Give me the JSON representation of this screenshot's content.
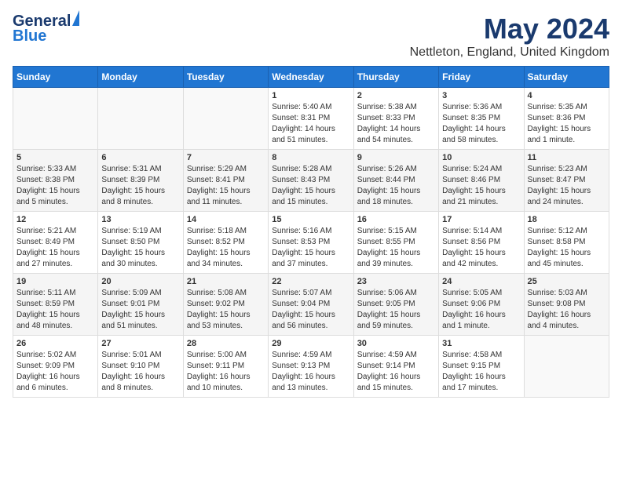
{
  "header": {
    "logo_line1": "General",
    "logo_line2": "Blue",
    "month_year": "May 2024",
    "location": "Nettleton, England, United Kingdom"
  },
  "weekdays": [
    "Sunday",
    "Monday",
    "Tuesday",
    "Wednesday",
    "Thursday",
    "Friday",
    "Saturday"
  ],
  "weeks": [
    [
      {
        "day": "",
        "info": ""
      },
      {
        "day": "",
        "info": ""
      },
      {
        "day": "",
        "info": ""
      },
      {
        "day": "1",
        "info": "Sunrise: 5:40 AM\nSunset: 8:31 PM\nDaylight: 14 hours\nand 51 minutes."
      },
      {
        "day": "2",
        "info": "Sunrise: 5:38 AM\nSunset: 8:33 PM\nDaylight: 14 hours\nand 54 minutes."
      },
      {
        "day": "3",
        "info": "Sunrise: 5:36 AM\nSunset: 8:35 PM\nDaylight: 14 hours\nand 58 minutes."
      },
      {
        "day": "4",
        "info": "Sunrise: 5:35 AM\nSunset: 8:36 PM\nDaylight: 15 hours\nand 1 minute."
      }
    ],
    [
      {
        "day": "5",
        "info": "Sunrise: 5:33 AM\nSunset: 8:38 PM\nDaylight: 15 hours\nand 5 minutes."
      },
      {
        "day": "6",
        "info": "Sunrise: 5:31 AM\nSunset: 8:39 PM\nDaylight: 15 hours\nand 8 minutes."
      },
      {
        "day": "7",
        "info": "Sunrise: 5:29 AM\nSunset: 8:41 PM\nDaylight: 15 hours\nand 11 minutes."
      },
      {
        "day": "8",
        "info": "Sunrise: 5:28 AM\nSunset: 8:43 PM\nDaylight: 15 hours\nand 15 minutes."
      },
      {
        "day": "9",
        "info": "Sunrise: 5:26 AM\nSunset: 8:44 PM\nDaylight: 15 hours\nand 18 minutes."
      },
      {
        "day": "10",
        "info": "Sunrise: 5:24 AM\nSunset: 8:46 PM\nDaylight: 15 hours\nand 21 minutes."
      },
      {
        "day": "11",
        "info": "Sunrise: 5:23 AM\nSunset: 8:47 PM\nDaylight: 15 hours\nand 24 minutes."
      }
    ],
    [
      {
        "day": "12",
        "info": "Sunrise: 5:21 AM\nSunset: 8:49 PM\nDaylight: 15 hours\nand 27 minutes."
      },
      {
        "day": "13",
        "info": "Sunrise: 5:19 AM\nSunset: 8:50 PM\nDaylight: 15 hours\nand 30 minutes."
      },
      {
        "day": "14",
        "info": "Sunrise: 5:18 AM\nSunset: 8:52 PM\nDaylight: 15 hours\nand 34 minutes."
      },
      {
        "day": "15",
        "info": "Sunrise: 5:16 AM\nSunset: 8:53 PM\nDaylight: 15 hours\nand 37 minutes."
      },
      {
        "day": "16",
        "info": "Sunrise: 5:15 AM\nSunset: 8:55 PM\nDaylight: 15 hours\nand 39 minutes."
      },
      {
        "day": "17",
        "info": "Sunrise: 5:14 AM\nSunset: 8:56 PM\nDaylight: 15 hours\nand 42 minutes."
      },
      {
        "day": "18",
        "info": "Sunrise: 5:12 AM\nSunset: 8:58 PM\nDaylight: 15 hours\nand 45 minutes."
      }
    ],
    [
      {
        "day": "19",
        "info": "Sunrise: 5:11 AM\nSunset: 8:59 PM\nDaylight: 15 hours\nand 48 minutes."
      },
      {
        "day": "20",
        "info": "Sunrise: 5:09 AM\nSunset: 9:01 PM\nDaylight: 15 hours\nand 51 minutes."
      },
      {
        "day": "21",
        "info": "Sunrise: 5:08 AM\nSunset: 9:02 PM\nDaylight: 15 hours\nand 53 minutes."
      },
      {
        "day": "22",
        "info": "Sunrise: 5:07 AM\nSunset: 9:04 PM\nDaylight: 15 hours\nand 56 minutes."
      },
      {
        "day": "23",
        "info": "Sunrise: 5:06 AM\nSunset: 9:05 PM\nDaylight: 15 hours\nand 59 minutes."
      },
      {
        "day": "24",
        "info": "Sunrise: 5:05 AM\nSunset: 9:06 PM\nDaylight: 16 hours\nand 1 minute."
      },
      {
        "day": "25",
        "info": "Sunrise: 5:03 AM\nSunset: 9:08 PM\nDaylight: 16 hours\nand 4 minutes."
      }
    ],
    [
      {
        "day": "26",
        "info": "Sunrise: 5:02 AM\nSunset: 9:09 PM\nDaylight: 16 hours\nand 6 minutes."
      },
      {
        "day": "27",
        "info": "Sunrise: 5:01 AM\nSunset: 9:10 PM\nDaylight: 16 hours\nand 8 minutes."
      },
      {
        "day": "28",
        "info": "Sunrise: 5:00 AM\nSunset: 9:11 PM\nDaylight: 16 hours\nand 10 minutes."
      },
      {
        "day": "29",
        "info": "Sunrise: 4:59 AM\nSunset: 9:13 PM\nDaylight: 16 hours\nand 13 minutes."
      },
      {
        "day": "30",
        "info": "Sunrise: 4:59 AM\nSunset: 9:14 PM\nDaylight: 16 hours\nand 15 minutes."
      },
      {
        "day": "31",
        "info": "Sunrise: 4:58 AM\nSunset: 9:15 PM\nDaylight: 16 hours\nand 17 minutes."
      },
      {
        "day": "",
        "info": ""
      }
    ]
  ]
}
